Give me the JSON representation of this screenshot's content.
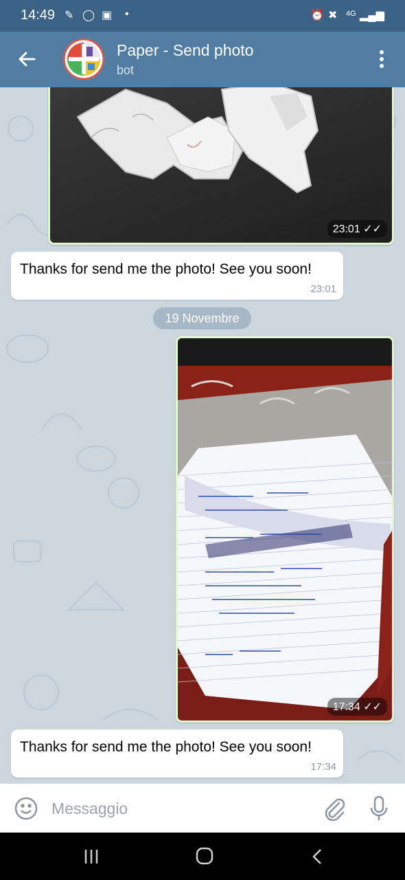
{
  "status_bar": {
    "time": "14:49"
  },
  "header": {
    "title": "Paper - Send photo",
    "subtitle": "bot"
  },
  "messages": [
    {
      "type": "photo",
      "time": "23:01"
    },
    {
      "type": "text",
      "text": "Thanks for send me the photo! See you soon!",
      "time": "23:01"
    },
    {
      "type": "date",
      "label": "19 Novembre"
    },
    {
      "type": "photo",
      "time": "17:34"
    },
    {
      "type": "text",
      "text": "Thanks for send me the photo! See you soon!",
      "time": "17:34"
    }
  ],
  "composer": {
    "placeholder": "Messaggio"
  },
  "icons": {
    "back": "arrow-left-icon",
    "menu": "more-vertical-icon",
    "emoji": "emoji-icon",
    "attach": "paperclip-icon",
    "mic": "microphone-icon",
    "nav_recents": "recents-icon",
    "nav_home": "home-icon",
    "nav_back": "back-nav-icon"
  },
  "colors": {
    "appbar": "#517da2",
    "statusbar": "#3c6286",
    "chat_bg": "#cbd6df",
    "outgoing": "#e1f7cf"
  }
}
